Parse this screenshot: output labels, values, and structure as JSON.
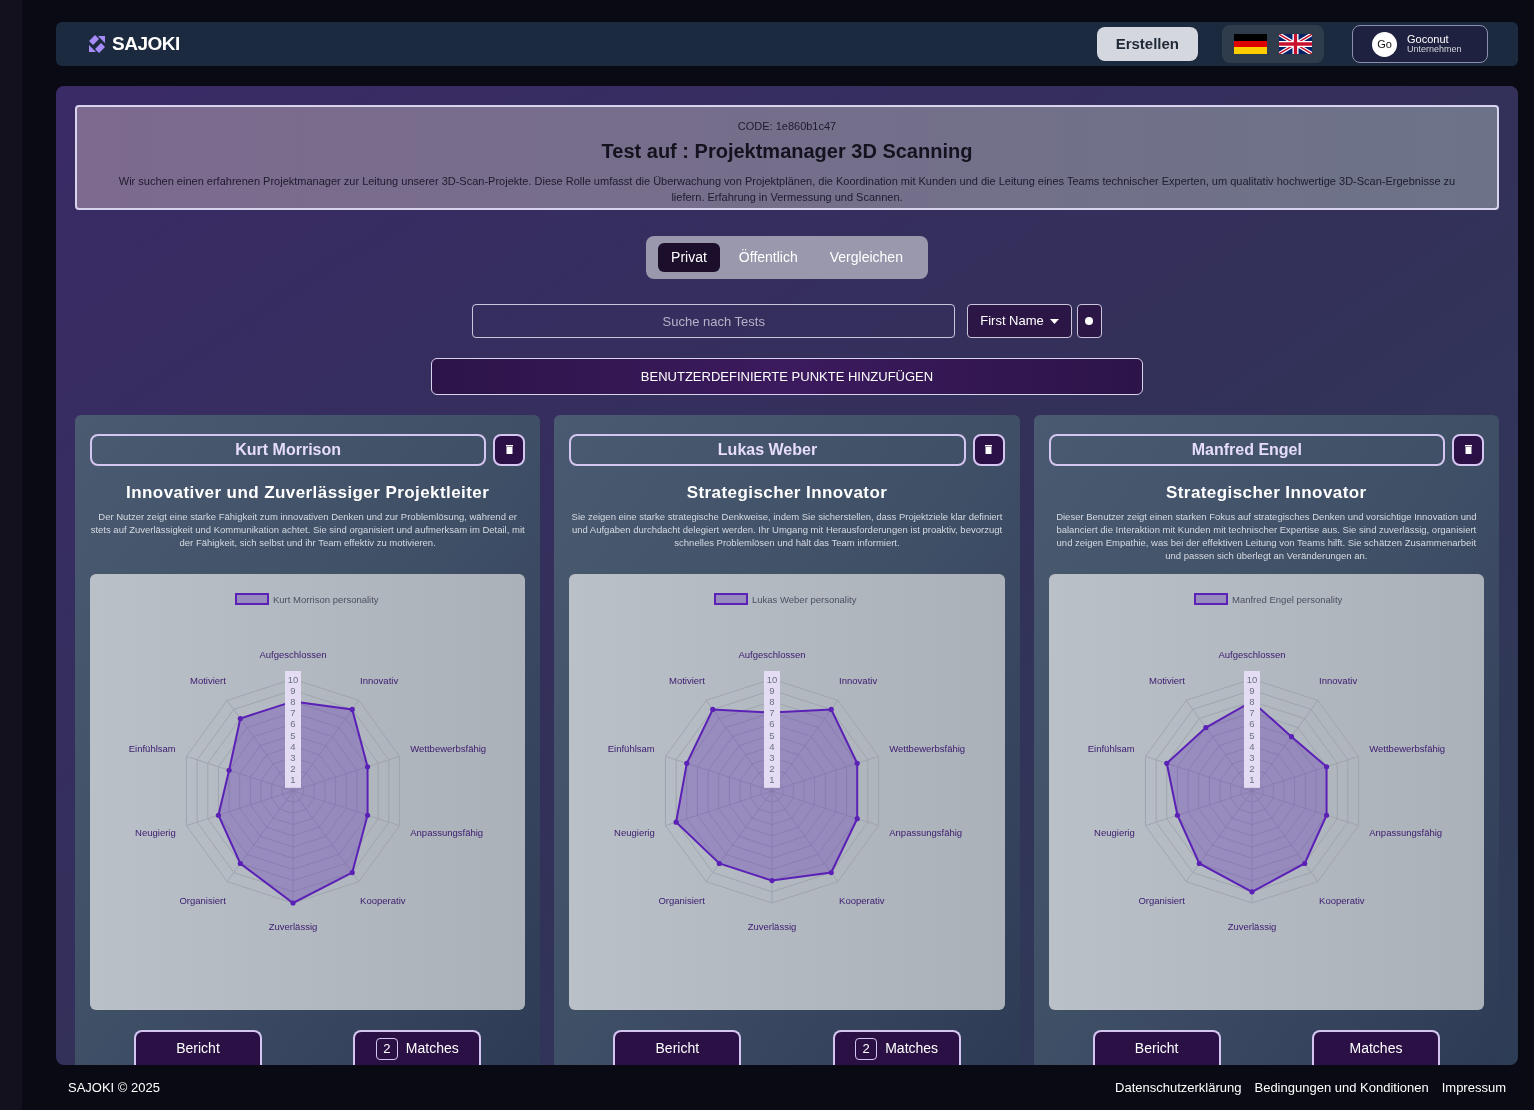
{
  "header": {
    "logo_text": "SAJOKI",
    "create_button": "Erstellen",
    "account": {
      "avatar_text": "Go",
      "name": "Goconut",
      "subtitle": "Unternehmen"
    }
  },
  "test": {
    "code": "CODE: 1e860b1c47",
    "title": "Test auf : Projektmanager 3D Scanning",
    "description": "Wir suchen einen erfahrenen Projektmanager zur Leitung unserer 3D-Scan-Projekte. Diese Rolle umfasst die Überwachung von Projektplänen, die Koordination mit Kunden und die Leitung eines Teams technischer Experten, um qualitativ hochwertige 3D-Scan-Ergebnisse zu liefern. Erfahrung in Vermessung und Scannen."
  },
  "tabs": [
    {
      "label": "Privat",
      "selected": true
    },
    {
      "label": "Öffentlich",
      "selected": false
    },
    {
      "label": "Vergleichen",
      "selected": false
    }
  ],
  "search": {
    "placeholder": "Suche nach Tests"
  },
  "sort_dropdown": "First Name",
  "add_points_button": "BENUTZERDEFINIERTE PUNKTE HINZUFÜGEN",
  "candidates": [
    {
      "name": "Kurt Morrison",
      "title": "Innovativer und Zuverlässiger Projektleiter",
      "description": "Der Nutzer zeigt eine starke Fähigkeit zum innovativen Denken und zur Problemlösung, während er stets auf Zuverlässigkeit und Kommunikation achtet. Sie sind organisiert und aufmerksam im Detail, mit der Fähigkeit, sich selbst und ihr Team effektiv zu motivieren.",
      "chart_data": {
        "type": "radar",
        "categories": [
          "Aufgeschlossen",
          "Innovativ",
          "Wettbewerbsfähig",
          "Anpassungsfähig",
          "Kooperativ",
          "Zuverlässig",
          "Organisiert",
          "Neugierig",
          "Einfühlsam",
          "Motiviert"
        ],
        "yticks": [
          1,
          2,
          3,
          4,
          5,
          6,
          7,
          8,
          9,
          10
        ],
        "ylim": [
          0,
          10
        ],
        "series": [
          {
            "name": "Kurt Morrison personality",
            "color": "#5b21b6",
            "values": [
              8,
              9,
              7,
              7,
              9,
              10,
              8,
              7,
              6,
              8
            ]
          }
        ]
      },
      "report_button": "Bericht",
      "matches_button": "Matches",
      "matches_count": "2"
    },
    {
      "name": "Lukas Weber",
      "title": "Strategischer Innovator",
      "description": "Sie zeigen eine starke strategische Denkweise, indem Sie sicherstellen, dass Projektziele klar definiert und Aufgaben durchdacht delegiert werden. Ihr Umgang mit Herausforderungen ist proaktiv, bevorzugt schnelles Problemlösen und hält das Team informiert.",
      "chart_data": {
        "type": "radar",
        "categories": [
          "Aufgeschlossen",
          "Innovativ",
          "Wettbewerbsfähig",
          "Anpassungsfähig",
          "Kooperativ",
          "Zuverlässig",
          "Organisiert",
          "Neugierig",
          "Einfühlsam",
          "Motiviert"
        ],
        "yticks": [
          1,
          2,
          3,
          4,
          5,
          6,
          7,
          8,
          9,
          10
        ],
        "ylim": [
          0,
          10
        ],
        "series": [
          {
            "name": "Lukas Weber personality",
            "color": "#5b21b6",
            "values": [
              7,
              9,
              8,
              8,
              9,
              8,
              8,
              9,
              8,
              9
            ]
          }
        ]
      },
      "report_button": "Bericht",
      "matches_button": "Matches",
      "matches_count": "2"
    },
    {
      "name": "Manfred Engel",
      "title": "Strategischer Innovator",
      "description": "Dieser Benutzer zeigt einen starken Fokus auf strategisches Denken und vorsichtige Innovation und balanciert die Interaktion mit Kunden mit technischer Expertise aus. Sie sind zuverlässig, organisiert und zeigen Empathie, was bei der effektiven Leitung von Teams hilft. Sie schätzen Zusammenarbeit und passen sich überlegt an Veränderungen an.",
      "chart_data": {
        "type": "radar",
        "categories": [
          "Aufgeschlossen",
          "Innovativ",
          "Wettbewerbsfähig",
          "Anpassungsfähig",
          "Kooperativ",
          "Zuverlässig",
          "Organisiert",
          "Neugierig",
          "Einfühlsam",
          "Motiviert"
        ],
        "yticks": [
          1,
          2,
          3,
          4,
          5,
          6,
          7,
          8,
          9,
          10
        ],
        "ylim": [
          0,
          10
        ],
        "series": [
          {
            "name": "Manfred Engel personality",
            "color": "#5b21b6",
            "values": [
              8,
              6,
              7,
              7,
              8,
              9,
              8,
              7,
              8,
              7
            ]
          }
        ]
      },
      "report_button": "Bericht",
      "matches_button": "Matches"
    }
  ],
  "footer": {
    "copyright": "SAJOKI © 2025",
    "links": [
      "Datenschutzerklärung",
      "Bedingungen und Konditionen",
      "Impressum"
    ]
  }
}
